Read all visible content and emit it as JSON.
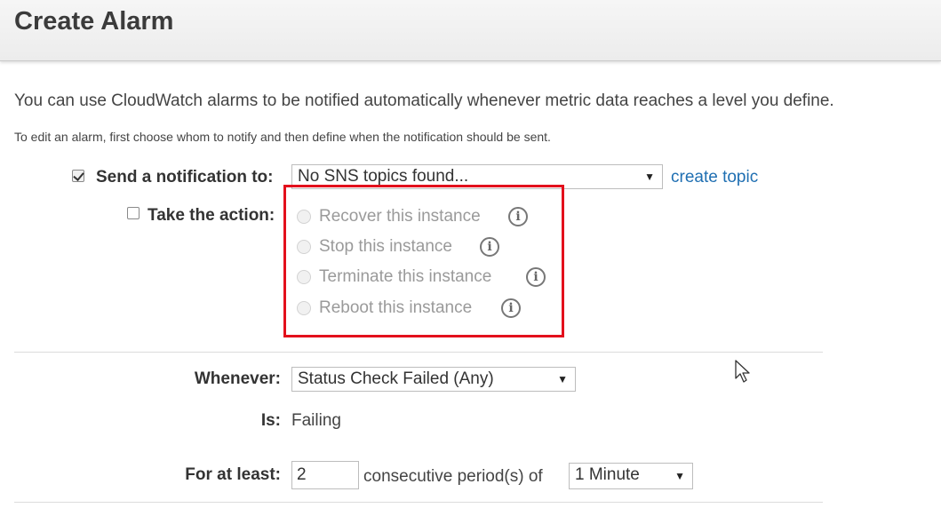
{
  "header": {
    "title": "Create Alarm"
  },
  "intro": {
    "description": "You can use CloudWatch alarms to be notified automatically whenever metric data reaches a level you define.",
    "sub_description": "To edit an alarm, first choose whom to notify and then define when the notification should be sent."
  },
  "notification": {
    "label": "Send a notification to:",
    "checked": true,
    "select_value": "No SNS topics found...",
    "create_link": "create topic"
  },
  "action": {
    "label": "Take the action:",
    "checked": false,
    "options": [
      {
        "label": "Recover this instance",
        "icon": "info-icon"
      },
      {
        "label": "Stop this instance",
        "icon": "info-icon"
      },
      {
        "label": "Terminate this instance",
        "icon": "info-icon"
      },
      {
        "label": "Reboot this instance",
        "icon": "info-icon"
      }
    ]
  },
  "whenever": {
    "label": "Whenever:",
    "value": "Status Check Failed (Any)"
  },
  "is": {
    "label": "Is:",
    "value": "Failing"
  },
  "for_at_least": {
    "label": "For at least:",
    "periods": "2",
    "text": "consecutive period(s) of",
    "period_value": "1 Minute"
  },
  "colors": {
    "highlight": "#e3101c",
    "link": "#1f6fb2"
  }
}
